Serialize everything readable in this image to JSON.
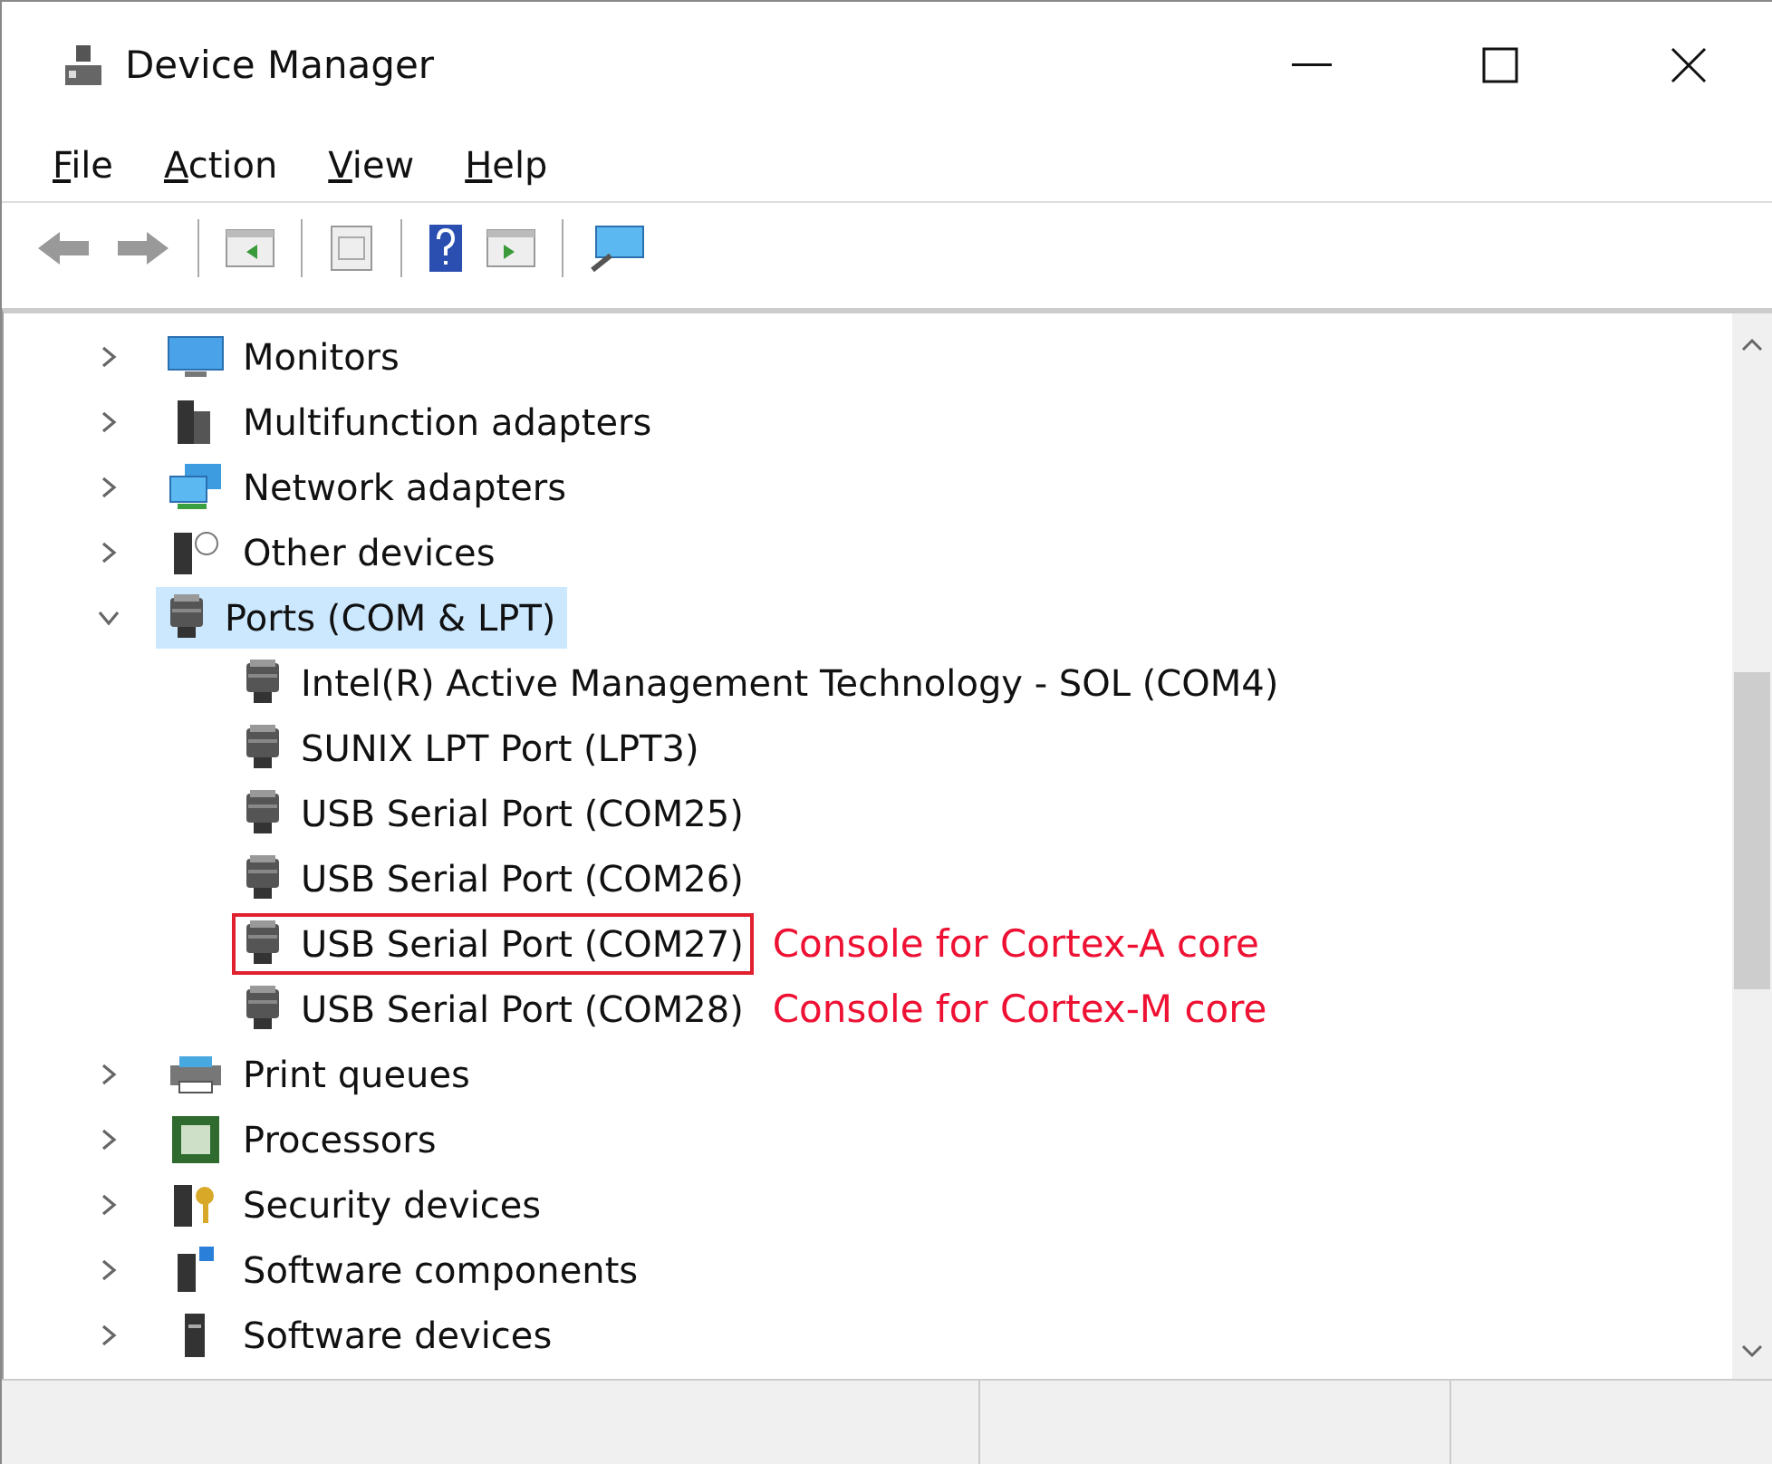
{
  "window": {
    "title": "Device Manager"
  },
  "menu": [
    "File",
    "Action",
    "View",
    "Help"
  ],
  "tree": [
    {
      "label": "Monitors",
      "expanded": false,
      "selected": false
    },
    {
      "label": "Multifunction adapters",
      "expanded": false,
      "selected": false
    },
    {
      "label": "Network adapters",
      "expanded": false,
      "selected": false
    },
    {
      "label": "Other devices",
      "expanded": false,
      "selected": false
    },
    {
      "label": "Ports (COM & LPT)",
      "expanded": true,
      "selected": true,
      "children": [
        {
          "label": "Intel(R) Active Management Technology - SOL (COM4)",
          "highlighted": false
        },
        {
          "label": "SUNIX LPT Port (LPT3)",
          "highlighted": false
        },
        {
          "label": "USB Serial Port (COM25)",
          "highlighted": false
        },
        {
          "label": "USB Serial Port (COM26)",
          "highlighted": false
        },
        {
          "label": "USB Serial Port (COM27)",
          "highlighted": true,
          "annotation": "Console for Cortex-A core"
        },
        {
          "label": "USB Serial Port (COM28)",
          "highlighted": false,
          "annotation": "Console for Cortex-M core"
        }
      ]
    },
    {
      "label": "Print queues",
      "expanded": false,
      "selected": false
    },
    {
      "label": "Processors",
      "expanded": false,
      "selected": false
    },
    {
      "label": "Security devices",
      "expanded": false,
      "selected": false
    },
    {
      "label": "Software components",
      "expanded": false,
      "selected": false
    },
    {
      "label": "Software devices",
      "expanded": false,
      "selected": false
    }
  ]
}
